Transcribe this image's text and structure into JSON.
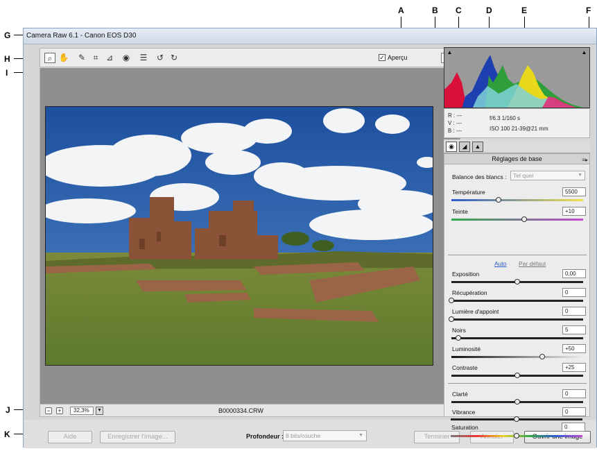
{
  "callouts": {
    "a": "A",
    "b": "B",
    "c": "C",
    "d": "D",
    "e": "E",
    "f": "F",
    "g": "G",
    "h": "H",
    "i": "I",
    "j": "J",
    "k": "K"
  },
  "window": {
    "title": "Camera Raw 6.1  -  Canon EOS D30"
  },
  "toolbar": {
    "tools": [
      "zoom-icon",
      "hand-icon",
      "eyedropper-icon",
      "crop-icon",
      "straighten-icon",
      "red-eye-icon",
      "preferences-icon",
      "rotate-left-icon",
      "rotate-right-icon"
    ],
    "preview_checked": "✓",
    "preview_label": "Aperçu",
    "fullscreen_symbol": "⇱"
  },
  "statusbar": {
    "zoom_out": "−",
    "zoom_in": "+",
    "zoom_value": "32,3%",
    "zoom_dropdown": "▼",
    "filename": "B0000334.CRW"
  },
  "readout": {
    "r": "R :  ---",
    "g": "V :  ---",
    "b": "B :  ---",
    "aperture_shutter": "f/6.3   1/160 s",
    "iso_lens": "ISO 100   21-39@21 mm"
  },
  "panel_tabs": [
    "basic-tab-icon",
    "tone-curve-tab-icon",
    "detail-tab-icon"
  ],
  "panel": {
    "title": "Réglages de base",
    "menu_symbol": "≡▸",
    "white_balance_label": "Balance des blancs :",
    "white_balance_value": "Tel quel",
    "auto_label": "Auto",
    "default_label": "Par défaut",
    "sliders": [
      {
        "label": "Température",
        "value": "5500",
        "position": 0.36
      },
      {
        "label": "Teinte",
        "value": "+10",
        "position": 0.55
      },
      {
        "label": "Exposition",
        "value": "0,00",
        "position": 0.5
      },
      {
        "label": "Récupération",
        "value": "0",
        "position": 0.0
      },
      {
        "label": "Lumière d'appoint",
        "value": "0",
        "position": 0.0
      },
      {
        "label": "Noirs",
        "value": "5",
        "position": 0.05
      },
      {
        "label": "Luminosité",
        "value": "+50",
        "position": 0.69
      },
      {
        "label": "Contraste",
        "value": "+25",
        "position": 0.5
      },
      {
        "label": "Clarté",
        "value": "0",
        "position": 0.5
      },
      {
        "label": "Vibrance",
        "value": "0",
        "position": 0.5
      },
      {
        "label": "Saturation",
        "value": "0",
        "position": 0.5
      }
    ]
  },
  "bottom": {
    "help": "Aide",
    "save_image": "Enregistrer l'image...",
    "depth_label": "Profondeur :",
    "depth_value": "8 bits/couche",
    "done": "Terminer",
    "cancel": "Annuler",
    "open_image": "Ouvrir une image"
  }
}
